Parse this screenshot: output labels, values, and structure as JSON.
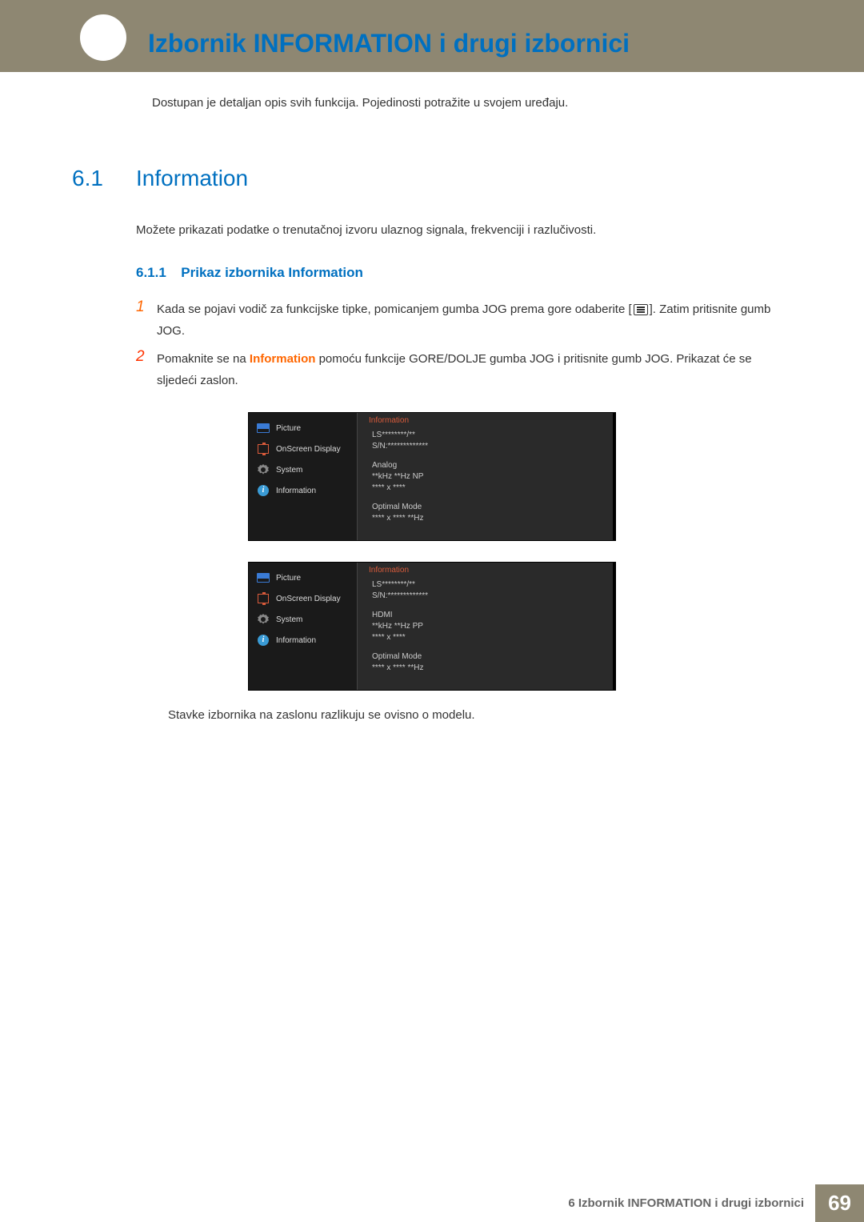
{
  "header": {
    "chapter_title": "Izbornik INFORMATION i drugi izbornici"
  },
  "intro": "Dostupan je detaljan opis svih funkcija. Pojedinosti potražite u svojem uređaju.",
  "section": {
    "num": "6.1",
    "title": "Information",
    "desc": "Možete prikazati podatke o trenutačnoj izvoru ulaznog signala, frekvenciji i razlučivosti."
  },
  "subsection": {
    "num": "6.1.1",
    "title": "Prikaz izbornika Information"
  },
  "steps": {
    "s1_a": "Kada se pojavi vodič za funkcijske tipke, pomicanjem gumba JOG prema gore odaberite [",
    "s1_b": "]. Zatim pritisnite gumb JOG.",
    "s2_a": "Pomaknite se na ",
    "s2_hl": "Information",
    "s2_b": " pomoću funkcije GORE/DOLJE gumba JOG i pritisnite gumb JOG. Prikazat će se sljedeći zaslon."
  },
  "osd_menu": {
    "items": [
      "Picture",
      "OnScreen Display",
      "System",
      "Information"
    ],
    "right_title": "Information"
  },
  "osd1": {
    "l1": "LS********/**",
    "l2": "S/N:*************",
    "l3": "Analog",
    "l4": "**kHz **Hz NP",
    "l5": "**** x ****",
    "l6": "Optimal Mode",
    "l7": "**** x **** **Hz"
  },
  "osd2": {
    "l1": "LS********/**",
    "l2": "S/N:*************",
    "l3": "HDMI",
    "l4": "**kHz **Hz PP",
    "l5": "**** x ****",
    "l6": "Optimal Mode",
    "l7": "**** x **** **Hz"
  },
  "note": "Stavke izbornika na zaslonu razlikuju se ovisno o modelu.",
  "footer": {
    "text": "6 Izbornik INFORMATION i drugi izbornici",
    "page": "69"
  }
}
